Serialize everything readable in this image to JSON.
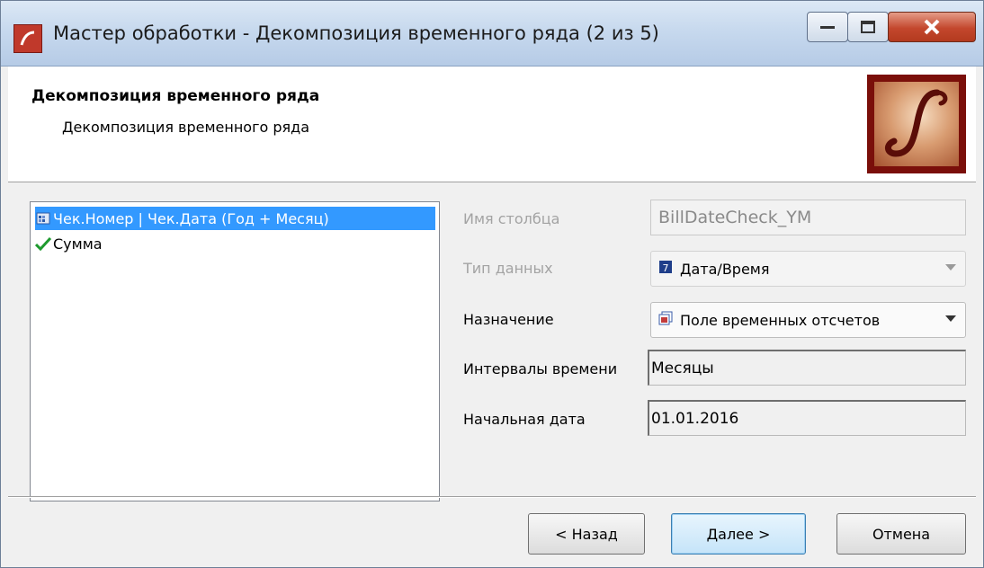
{
  "window": {
    "title": "Мастер обработки - Декомпозиция временного ряда (2 из 5)"
  },
  "header": {
    "title": "Декомпозиция временного ряда",
    "subtitle": "Декомпозиция временного ряда"
  },
  "fields_list": {
    "items": [
      {
        "label": "Чек.Номер | Чек.Дата (Год + Месяц)",
        "icon": "date-field-icon",
        "selected": true
      },
      {
        "label": "Сумма",
        "icon": "checkmark-icon",
        "selected": false
      }
    ]
  },
  "properties": {
    "column_name": {
      "label": "Имя столбца",
      "value": "BillDateCheck_YM"
    },
    "data_type": {
      "label": "Тип данных",
      "value": "Дата/Время",
      "icon": "calendar-icon"
    },
    "purpose": {
      "label": "Назначение",
      "value": "Поле временных отсчетов",
      "icon": "calendar-pages-icon"
    },
    "time_intervals": {
      "label": "Интервалы времени",
      "value": "Месяцы"
    },
    "start_date": {
      "label": "Начальная дата",
      "value": "01.01.2016"
    }
  },
  "buttons": {
    "back": "< Назад",
    "next": "Далее >",
    "cancel": "Отмена"
  },
  "colors": {
    "selection": "#3399ff",
    "logo_background": "#7a0f0a",
    "close_button": "#c3472d"
  }
}
